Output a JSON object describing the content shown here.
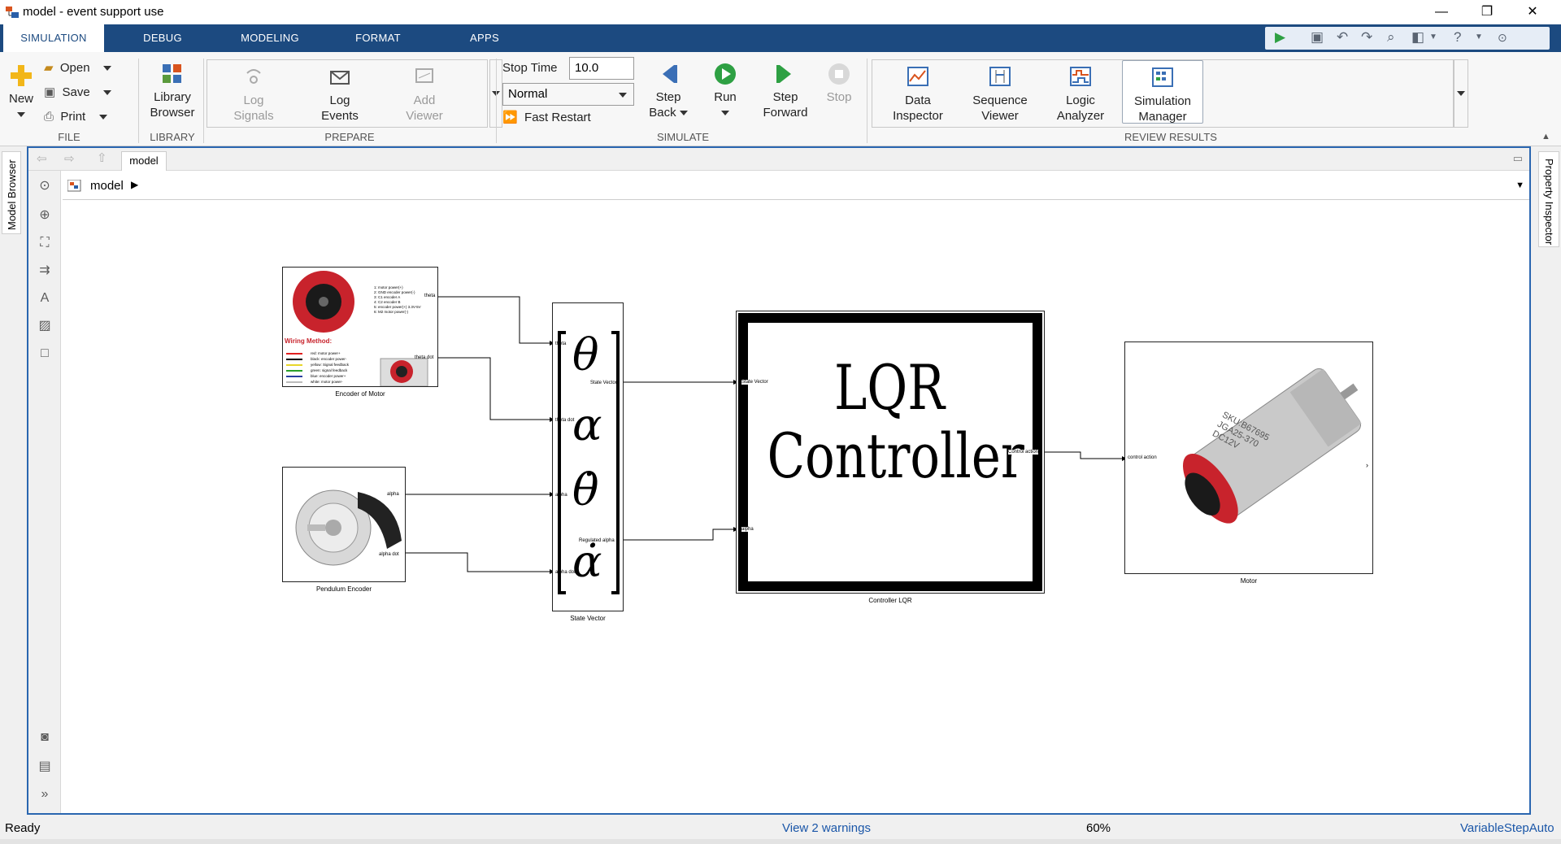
{
  "window": {
    "title": "model - event support use",
    "controls": {
      "minimize": "—",
      "restore": "❐",
      "close": "✕"
    }
  },
  "tabs": [
    {
      "label": "SIMULATION",
      "active": true
    },
    {
      "label": "DEBUG"
    },
    {
      "label": "MODELING"
    },
    {
      "label": "FORMAT"
    },
    {
      "label": "APPS"
    }
  ],
  "ribbon": {
    "file": {
      "new_label": "New",
      "open_label": "Open",
      "save_label": "Save",
      "print_label": "Print",
      "group_label": "FILE"
    },
    "library": {
      "browser_label_1": "Library",
      "browser_label_2": "Browser",
      "group_label": "LIBRARY"
    },
    "prepare": {
      "log_signals_1": "Log",
      "log_signals_2": "Signals",
      "log_events_1": "Log",
      "log_events_2": "Events",
      "add_viewer_1": "Add",
      "add_viewer_2": "Viewer",
      "group_label": "PREPARE"
    },
    "simulate": {
      "stop_time_label": "Stop Time",
      "stop_time_value": "10.0",
      "mode_value": "Normal",
      "fast_restart_label": "Fast Restart",
      "step_back_1": "Step",
      "step_back_2": "Back",
      "run_label": "Run",
      "step_forward_1": "Step",
      "step_forward_2": "Forward",
      "stop_label": "Stop",
      "group_label": "SIMULATE"
    },
    "review": {
      "data_inspector_1": "Data",
      "data_inspector_2": "Inspector",
      "sequence_viewer_1": "Sequence",
      "sequence_viewer_2": "Viewer",
      "logic_analyzer_1": "Logic",
      "logic_analyzer_2": "Analyzer",
      "sim_manager_1": "Simulation",
      "sim_manager_2": "Manager",
      "group_label": "REVIEW RESULTS"
    }
  },
  "side_panels": {
    "left": "Model Browser",
    "right": "Property Inspector"
  },
  "editor": {
    "tab_label": "model",
    "breadcrumb": "model"
  },
  "diagram": {
    "encoder_motor": {
      "label": "Encoder of Motor",
      "port_theta": "theta",
      "port_theta_dot": "theta dot",
      "wiring_title": "Wiring Method:",
      "pin_lines": [
        "1: motor power(+)",
        "2: GND encoder power(-)",
        "3: C1 encoder A",
        "4: C2 encoder B",
        "5: encoder power(+) 3.3V-5V",
        "6: M2 motor power(-)"
      ],
      "legend_lines": [
        "red: motor power+",
        "black: encoder power-",
        "yellow: Signal feedback",
        "green: signal feedback",
        "blue: encoder power+",
        "white: motor power-"
      ]
    },
    "pendulum_encoder": {
      "label": "Pendulum Encoder",
      "port_alpha": "alpha",
      "port_alpha_dot": "alpha dot"
    },
    "state_vector": {
      "label": "State Vector",
      "in_ports": [
        "theta",
        "theta dot",
        "alpha",
        "alpha dot"
      ],
      "out_ports": [
        "State Vector",
        "Regulated alpha"
      ],
      "symbols": [
        "θ",
        "α",
        "θ̇",
        "α̇"
      ]
    },
    "controller": {
      "label": "Controller LQR",
      "title_line_1": "LQR",
      "title_line_2": "Controller",
      "in_port_1": "State Vector",
      "in_port_2": "alpha",
      "out_port": "Control action"
    },
    "motor": {
      "label": "Motor",
      "in_port": "control action",
      "printed_text_1": "SKU:B67695",
      "printed_text_2": "JGA25-370",
      "printed_text_3": "DC12V"
    }
  },
  "status": {
    "left": "Ready",
    "warnings": "View 2 warnings",
    "zoom": "60%",
    "solver": "VariableStepAuto"
  }
}
